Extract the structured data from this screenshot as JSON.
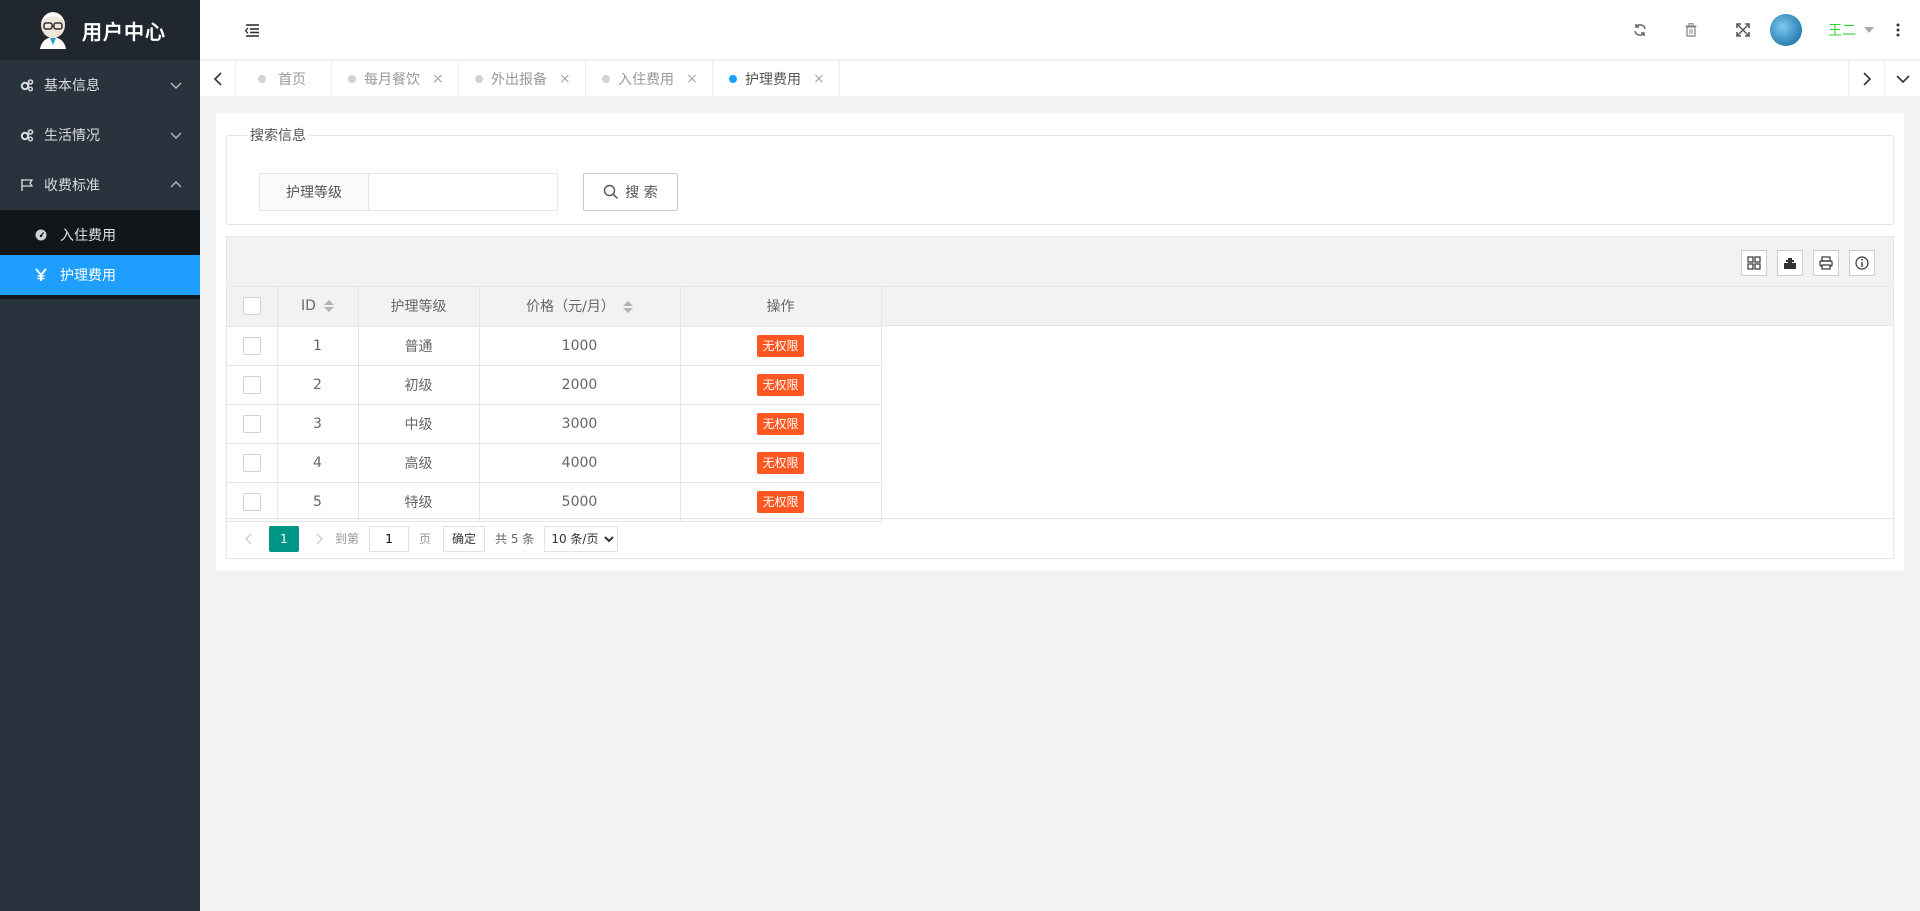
{
  "app": {
    "title": "用户中心"
  },
  "sidebar": {
    "items": [
      {
        "label": "基本信息",
        "icon": "gears-icon",
        "expanded": false
      },
      {
        "label": "生活情况",
        "icon": "gears-icon",
        "expanded": false
      },
      {
        "label": "收费标准",
        "icon": "flag-icon",
        "expanded": true
      }
    ],
    "sub_items": [
      {
        "label": "入住费用",
        "icon": "dashboard-icon",
        "active": false
      },
      {
        "label": "护理费用",
        "icon": "yen-icon",
        "active": true
      }
    ]
  },
  "header": {
    "user_name": "王二",
    "icons": [
      "menu-toggle-icon",
      "refresh-icon",
      "trash-icon",
      "fullscreen-icon",
      "more-icon"
    ]
  },
  "tabs": [
    {
      "label": "首页",
      "closable": false,
      "active": false
    },
    {
      "label": "每月餐饮",
      "closable": true,
      "active": false
    },
    {
      "label": "外出报备",
      "closable": true,
      "active": false
    },
    {
      "label": "入住费用",
      "closable": true,
      "active": false
    },
    {
      "label": "护理费用",
      "closable": true,
      "active": true
    }
  ],
  "search": {
    "legend": "搜索信息",
    "field_label": "护理等级",
    "field_value": "",
    "button_label": "搜 索"
  },
  "table": {
    "columns": [
      "ID",
      "护理等级",
      "价格（元/月）",
      "操作"
    ],
    "rows": [
      {
        "id": "1",
        "level": "普通",
        "price": "1000",
        "action": "无权限"
      },
      {
        "id": "2",
        "level": "初级",
        "price": "2000",
        "action": "无权限"
      },
      {
        "id": "3",
        "level": "中级",
        "price": "3000",
        "action": "无权限"
      },
      {
        "id": "4",
        "level": "高级",
        "price": "4000",
        "action": "无权限"
      },
      {
        "id": "5",
        "level": "特级",
        "price": "5000",
        "action": "无权限"
      }
    ]
  },
  "pager": {
    "current": "1",
    "goto_label": "到第",
    "goto_value": "1",
    "page_unit": "页",
    "confirm": "确定",
    "total": "共 5 条",
    "page_size": "10 条/页",
    "page_size_options": [
      "10 条/页"
    ]
  },
  "colors": {
    "sidebar_bg": "#28333e",
    "active_blue": "#1e9fff",
    "badge_orange": "#ff5722",
    "pager_green": "#009688",
    "user_green": "#34d434"
  }
}
